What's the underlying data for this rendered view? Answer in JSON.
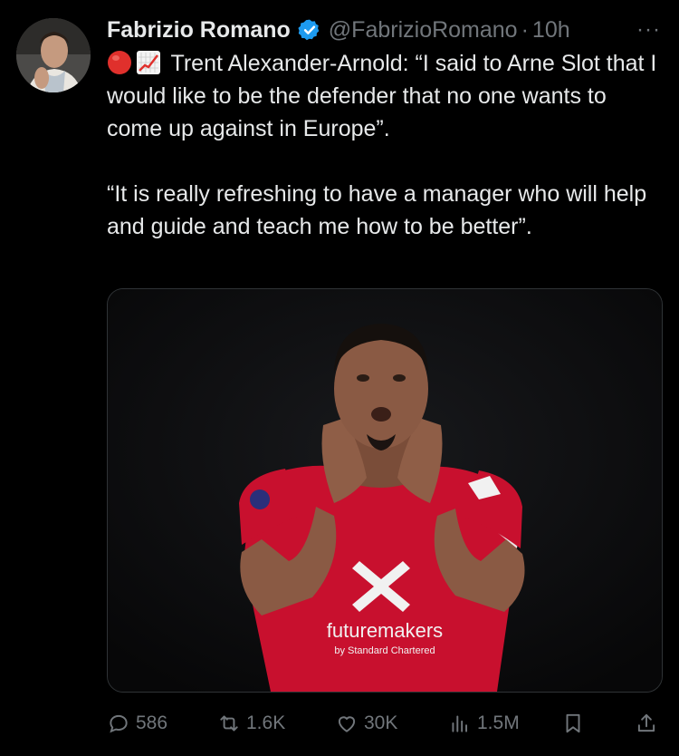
{
  "tweet": {
    "author_name": "Fabrizio Romano",
    "handle": "@FabrizioRomano",
    "separator": "·",
    "time": "10h",
    "more": "···",
    "paragraph1": "Trent Alexander-Arnold: “I said to Arne Slot that I would like to be the defender that no one wants to come up against in Europe”.",
    "paragraph2": "“It is really refreshing to have a manager who will help and guide and teach me how to be better”.",
    "emoji": [
      "red-circle",
      "chart-increasing"
    ],
    "media": {
      "sponsor_line1": "futuremakers",
      "sponsor_line2": "by Standard Chartered",
      "sleeve_text": "sleeve badge"
    }
  },
  "actions": {
    "replies": "586",
    "retweets": "1.6K",
    "likes": "30K",
    "views": "1.5M"
  },
  "colors": {
    "background": "#000000",
    "text": "#e7e9ea",
    "muted": "#71767b",
    "verified": "#1d9bf0",
    "jersey": "#c8102e"
  }
}
